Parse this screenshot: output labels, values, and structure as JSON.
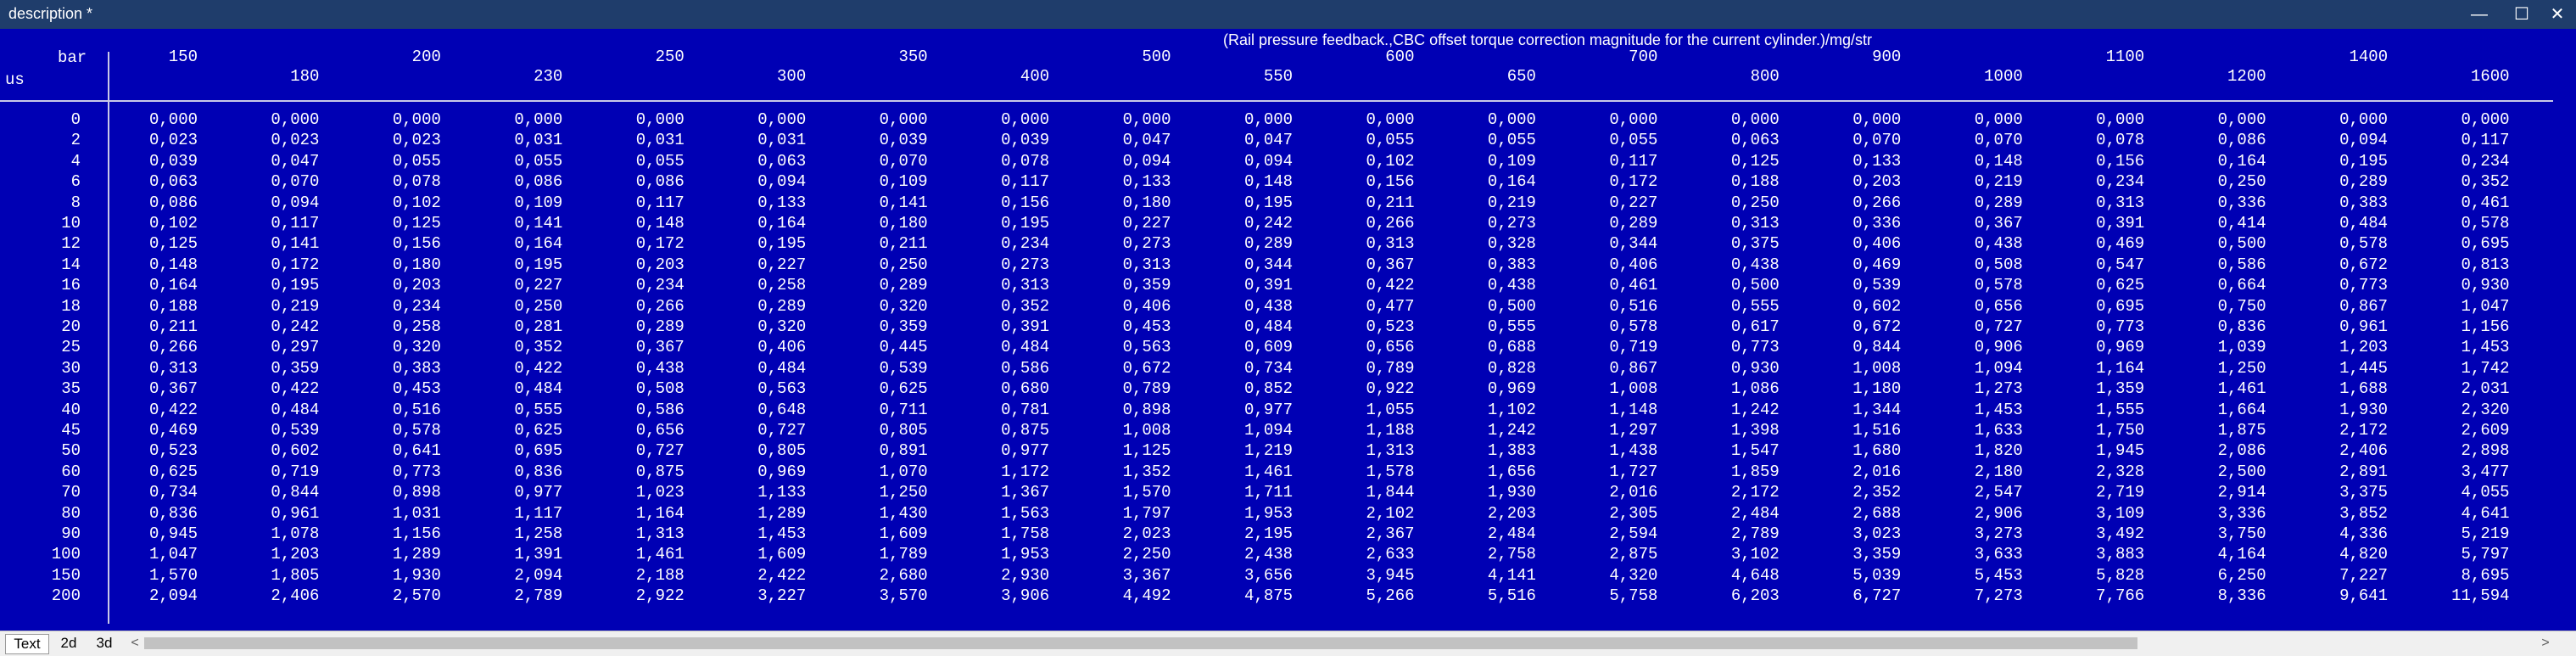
{
  "window": {
    "title": "description *",
    "minimize_glyph": "—",
    "maximize_glyph": "☐",
    "close_glyph": "✕"
  },
  "map": {
    "title": "(Rail pressure feedback.,CBC offset torque correction magnitude for the current cylinder.)/mg/str",
    "x_axis_unit": "bar",
    "y_axis_unit": "us",
    "columns": [
      "150",
      "180",
      "200",
      "230",
      "250",
      "300",
      "350",
      "400",
      "500",
      "550",
      "600",
      "650",
      "700",
      "800",
      "900",
      "1000",
      "1100",
      "1200",
      "1400",
      "1600"
    ],
    "rows": [
      {
        "label": "0",
        "values": [
          "0,000",
          "0,000",
          "0,000",
          "0,000",
          "0,000",
          "0,000",
          "0,000",
          "0,000",
          "0,000",
          "0,000",
          "0,000",
          "0,000",
          "0,000",
          "0,000",
          "0,000",
          "0,000",
          "0,000",
          "0,000",
          "0,000",
          "0,000"
        ]
      },
      {
        "label": "2",
        "values": [
          "0,023",
          "0,023",
          "0,023",
          "0,031",
          "0,031",
          "0,031",
          "0,039",
          "0,039",
          "0,047",
          "0,047",
          "0,055",
          "0,055",
          "0,055",
          "0,063",
          "0,070",
          "0,070",
          "0,078",
          "0,086",
          "0,094",
          "0,117"
        ]
      },
      {
        "label": "4",
        "values": [
          "0,039",
          "0,047",
          "0,055",
          "0,055",
          "0,055",
          "0,063",
          "0,070",
          "0,078",
          "0,094",
          "0,094",
          "0,102",
          "0,109",
          "0,117",
          "0,125",
          "0,133",
          "0,148",
          "0,156",
          "0,164",
          "0,195",
          "0,234"
        ]
      },
      {
        "label": "6",
        "values": [
          "0,063",
          "0,070",
          "0,078",
          "0,086",
          "0,086",
          "0,094",
          "0,109",
          "0,117",
          "0,133",
          "0,148",
          "0,156",
          "0,164",
          "0,172",
          "0,188",
          "0,203",
          "0,219",
          "0,234",
          "0,250",
          "0,289",
          "0,352"
        ]
      },
      {
        "label": "8",
        "values": [
          "0,086",
          "0,094",
          "0,102",
          "0,109",
          "0,117",
          "0,133",
          "0,141",
          "0,156",
          "0,180",
          "0,195",
          "0,211",
          "0,219",
          "0,227",
          "0,250",
          "0,266",
          "0,289",
          "0,313",
          "0,336",
          "0,383",
          "0,461"
        ]
      },
      {
        "label": "10",
        "values": [
          "0,102",
          "0,117",
          "0,125",
          "0,141",
          "0,148",
          "0,164",
          "0,180",
          "0,195",
          "0,227",
          "0,242",
          "0,266",
          "0,273",
          "0,289",
          "0,313",
          "0,336",
          "0,367",
          "0,391",
          "0,414",
          "0,484",
          "0,578"
        ]
      },
      {
        "label": "12",
        "values": [
          "0,125",
          "0,141",
          "0,156",
          "0,164",
          "0,172",
          "0,195",
          "0,211",
          "0,234",
          "0,273",
          "0,289",
          "0,313",
          "0,328",
          "0,344",
          "0,375",
          "0,406",
          "0,438",
          "0,469",
          "0,500",
          "0,578",
          "0,695"
        ]
      },
      {
        "label": "14",
        "values": [
          "0,148",
          "0,172",
          "0,180",
          "0,195",
          "0,203",
          "0,227",
          "0,250",
          "0,273",
          "0,313",
          "0,344",
          "0,367",
          "0,383",
          "0,406",
          "0,438",
          "0,469",
          "0,508",
          "0,547",
          "0,586",
          "0,672",
          "0,813"
        ]
      },
      {
        "label": "16",
        "values": [
          "0,164",
          "0,195",
          "0,203",
          "0,227",
          "0,234",
          "0,258",
          "0,289",
          "0,313",
          "0,359",
          "0,391",
          "0,422",
          "0,438",
          "0,461",
          "0,500",
          "0,539",
          "0,578",
          "0,625",
          "0,664",
          "0,773",
          "0,930"
        ]
      },
      {
        "label": "18",
        "values": [
          "0,188",
          "0,219",
          "0,234",
          "0,250",
          "0,266",
          "0,289",
          "0,320",
          "0,352",
          "0,406",
          "0,438",
          "0,477",
          "0,500",
          "0,516",
          "0,555",
          "0,602",
          "0,656",
          "0,695",
          "0,750",
          "0,867",
          "1,047"
        ]
      },
      {
        "label": "20",
        "values": [
          "0,211",
          "0,242",
          "0,258",
          "0,281",
          "0,289",
          "0,320",
          "0,359",
          "0,391",
          "0,453",
          "0,484",
          "0,523",
          "0,555",
          "0,578",
          "0,617",
          "0,672",
          "0,727",
          "0,773",
          "0,836",
          "0,961",
          "1,156"
        ]
      },
      {
        "label": "25",
        "values": [
          "0,266",
          "0,297",
          "0,320",
          "0,352",
          "0,367",
          "0,406",
          "0,445",
          "0,484",
          "0,563",
          "0,609",
          "0,656",
          "0,688",
          "0,719",
          "0,773",
          "0,844",
          "0,906",
          "0,969",
          "1,039",
          "1,203",
          "1,453"
        ]
      },
      {
        "label": "30",
        "values": [
          "0,313",
          "0,359",
          "0,383",
          "0,422",
          "0,438",
          "0,484",
          "0,539",
          "0,586",
          "0,672",
          "0,734",
          "0,789",
          "0,828",
          "0,867",
          "0,930",
          "1,008",
          "1,094",
          "1,164",
          "1,250",
          "1,445",
          "1,742"
        ]
      },
      {
        "label": "35",
        "values": [
          "0,367",
          "0,422",
          "0,453",
          "0,484",
          "0,508",
          "0,563",
          "0,625",
          "0,680",
          "0,789",
          "0,852",
          "0,922",
          "0,969",
          "1,008",
          "1,086",
          "1,180",
          "1,273",
          "1,359",
          "1,461",
          "1,688",
          "2,031"
        ]
      },
      {
        "label": "40",
        "values": [
          "0,422",
          "0,484",
          "0,516",
          "0,555",
          "0,586",
          "0,648",
          "0,711",
          "0,781",
          "0,898",
          "0,977",
          "1,055",
          "1,102",
          "1,148",
          "1,242",
          "1,344",
          "1,453",
          "1,555",
          "1,664",
          "1,930",
          "2,320"
        ]
      },
      {
        "label": "45",
        "values": [
          "0,469",
          "0,539",
          "0,578",
          "0,625",
          "0,656",
          "0,727",
          "0,805",
          "0,875",
          "1,008",
          "1,094",
          "1,188",
          "1,242",
          "1,297",
          "1,398",
          "1,516",
          "1,633",
          "1,750",
          "1,875",
          "2,172",
          "2,609"
        ]
      },
      {
        "label": "50",
        "values": [
          "0,523",
          "0,602",
          "0,641",
          "0,695",
          "0,727",
          "0,805",
          "0,891",
          "0,977",
          "1,125",
          "1,219",
          "1,313",
          "1,383",
          "1,438",
          "1,547",
          "1,680",
          "1,820",
          "1,945",
          "2,086",
          "2,406",
          "2,898"
        ]
      },
      {
        "label": "60",
        "values": [
          "0,625",
          "0,719",
          "0,773",
          "0,836",
          "0,875",
          "0,969",
          "1,070",
          "1,172",
          "1,352",
          "1,461",
          "1,578",
          "1,656",
          "1,727",
          "1,859",
          "2,016",
          "2,180",
          "2,328",
          "2,500",
          "2,891",
          "3,477"
        ]
      },
      {
        "label": "70",
        "values": [
          "0,734",
          "0,844",
          "0,898",
          "0,977",
          "1,023",
          "1,133",
          "1,250",
          "1,367",
          "1,570",
          "1,711",
          "1,844",
          "1,930",
          "2,016",
          "2,172",
          "2,352",
          "2,547",
          "2,719",
          "2,914",
          "3,375",
          "4,055"
        ]
      },
      {
        "label": "80",
        "values": [
          "0,836",
          "0,961",
          "1,031",
          "1,117",
          "1,164",
          "1,289",
          "1,430",
          "1,563",
          "1,797",
          "1,953",
          "2,102",
          "2,203",
          "2,305",
          "2,484",
          "2,688",
          "2,906",
          "3,109",
          "3,336",
          "3,852",
          "4,641"
        ]
      },
      {
        "label": "90",
        "values": [
          "0,945",
          "1,078",
          "1,156",
          "1,258",
          "1,313",
          "1,453",
          "1,609",
          "1,758",
          "2,023",
          "2,195",
          "2,367",
          "2,484",
          "2,594",
          "2,789",
          "3,023",
          "3,273",
          "3,492",
          "3,750",
          "4,336",
          "5,219"
        ]
      },
      {
        "label": "100",
        "values": [
          "1,047",
          "1,203",
          "1,289",
          "1,391",
          "1,461",
          "1,609",
          "1,789",
          "1,953",
          "2,250",
          "2,438",
          "2,633",
          "2,758",
          "2,875",
          "3,102",
          "3,359",
          "3,633",
          "3,883",
          "4,164",
          "4,820",
          "5,797"
        ]
      },
      {
        "label": "150",
        "values": [
          "1,570",
          "1,805",
          "1,930",
          "2,094",
          "2,188",
          "2,422",
          "2,680",
          "2,930",
          "3,367",
          "3,656",
          "3,945",
          "4,141",
          "4,320",
          "4,648",
          "5,039",
          "5,453",
          "5,828",
          "6,250",
          "7,227",
          "8,695"
        ]
      },
      {
        "label": "200",
        "values": [
          "2,094",
          "2,406",
          "2,570",
          "2,789",
          "2,922",
          "3,227",
          "3,570",
          "3,906",
          "4,492",
          "4,875",
          "5,266",
          "5,516",
          "5,758",
          "6,203",
          "6,727",
          "7,273",
          "7,766",
          "8,336",
          "9,641",
          "11,594"
        ]
      }
    ]
  },
  "tabs": [
    {
      "label": "Text"
    },
    {
      "label": "2d"
    },
    {
      "label": "3d"
    }
  ],
  "scrollbar": {
    "left_glyph": "<",
    "right_glyph": ">"
  }
}
